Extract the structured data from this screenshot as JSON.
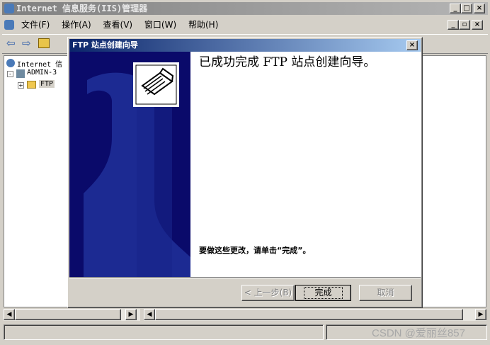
{
  "app": {
    "title": "Internet 信息服务(IIS)管理器"
  },
  "menu": {
    "file": "文件(F)",
    "action": "操作(A)",
    "view": "查看(V)",
    "window": "窗口(W)",
    "help": "帮助(H)"
  },
  "tree": {
    "root": "Internet 信",
    "server": "ADMIN-3",
    "ftp": "FTP"
  },
  "dialog": {
    "title": "FTP 站点创建向导",
    "heading": "已成功完成 FTP 站点创建向导。",
    "instruction": "要做这些更改，请单击“完成”。",
    "back_label": "< 上一步(B)",
    "finish_label": "完成",
    "cancel_label": "取消"
  },
  "watermark": "CSDN @爱丽丝857"
}
